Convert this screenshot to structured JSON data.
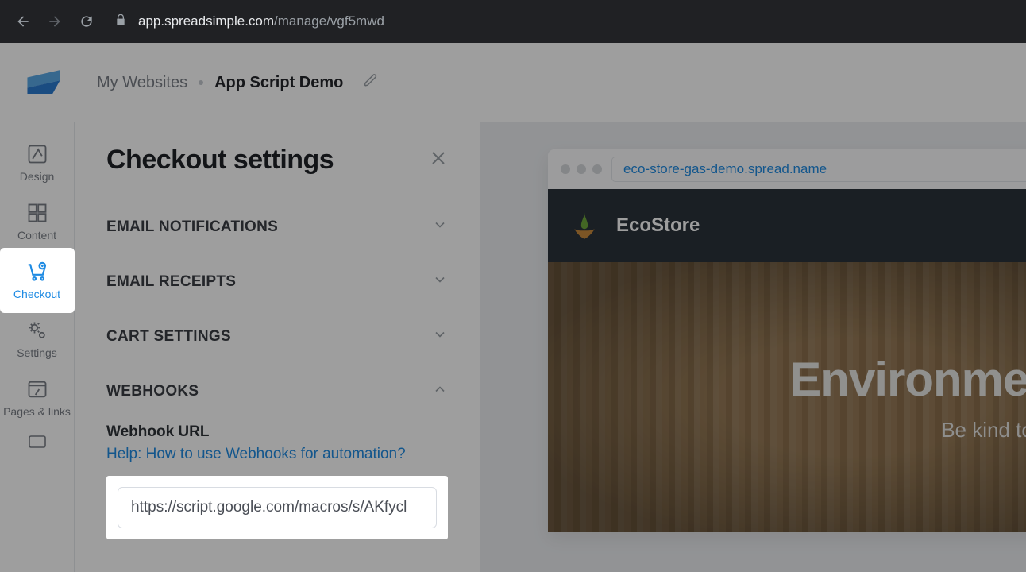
{
  "browser": {
    "url_host": "app.spreadsimple.com",
    "url_path": "/manage/vgf5mwd"
  },
  "breadcrumb": {
    "root": "My Websites",
    "current": "App Script Demo"
  },
  "rail": {
    "design": "Design",
    "content": "Content",
    "checkout": "Checkout",
    "settings": "Settings",
    "pages": "Pages & links"
  },
  "panel": {
    "title": "Checkout settings",
    "sections": {
      "email_notifications": "EMAIL NOTIFICATIONS",
      "email_receipts": "EMAIL RECEIPTS",
      "cart_settings": "CART SETTINGS",
      "webhooks": "WEBHOOKS"
    },
    "webhook": {
      "label": "Webhook URL",
      "help": "Help: How to use Webhooks for automation?",
      "value": "https://script.google.com/macros/s/AKfycl"
    }
  },
  "preview": {
    "url": "eco-store-gas-demo.spread.name",
    "site_name": "EcoStore",
    "hero_title": "Environment",
    "hero_sub": "Be kind to you"
  }
}
